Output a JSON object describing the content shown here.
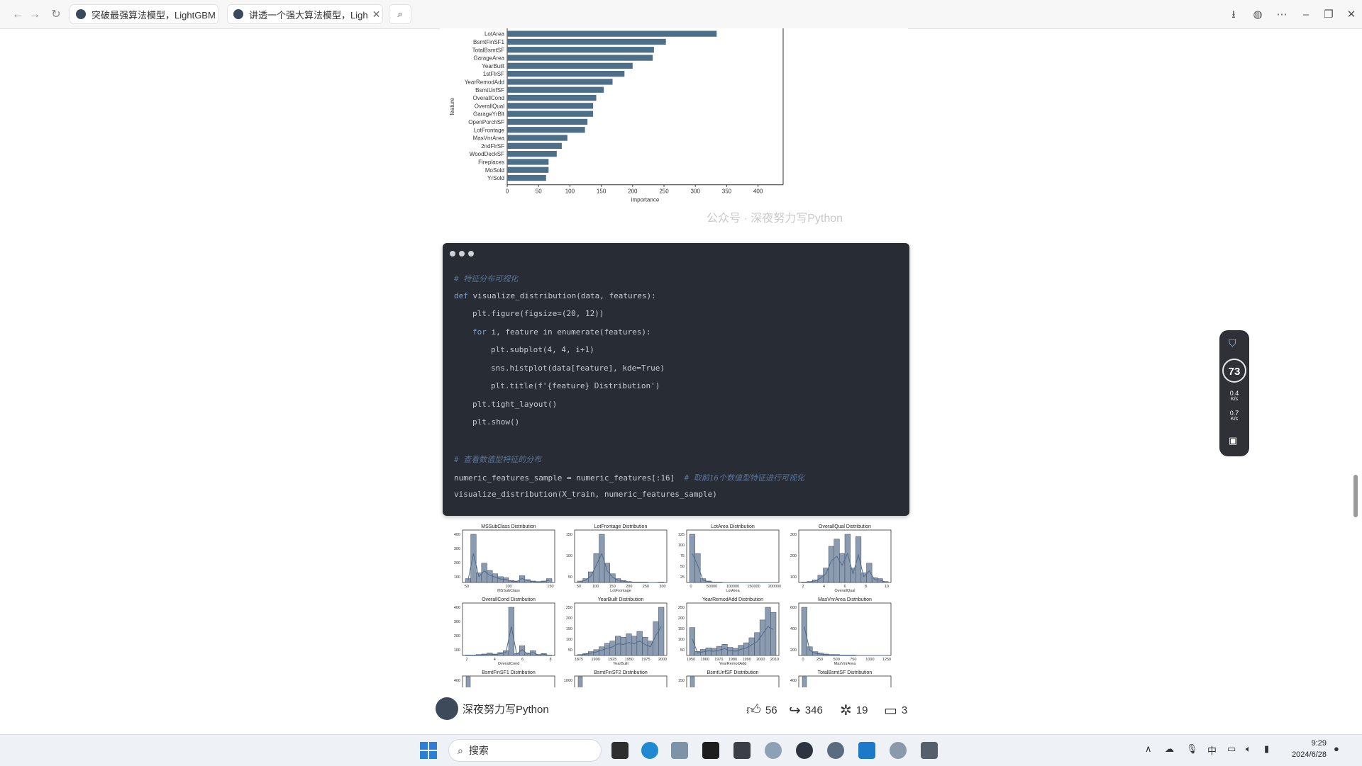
{
  "browser": {
    "tabs": [
      {
        "title": "突破最强算法模型，LightGBM !",
        "active": true
      },
      {
        "title": "讲透一个强大算法模型，Ligh",
        "active": false
      }
    ]
  },
  "feature_chart": {
    "type": "bar",
    "orientation": "horizontal",
    "categories": [
      "LotArea",
      "BsmtFinSF1",
      "TotalBsmtSF",
      "GarageArea",
      "YearBuilt",
      "1stFlrSF",
      "YearRemodAdd",
      "BsmtUnfSF",
      "OverallCond",
      "OverallQual",
      "GarageYrBlt",
      "OpenPorchSF",
      "LotFrontage",
      "MasVnrArea",
      "2ndFlrSF",
      "WoodDeckSF",
      "Fireplaces",
      "MoSold",
      "YrSold"
    ],
    "values": [
      334,
      253,
      234,
      232,
      200,
      187,
      168,
      154,
      142,
      137,
      137,
      128,
      124,
      96,
      87,
      79,
      66,
      66,
      62
    ],
    "xlabel": "importance",
    "ylabel": "feature",
    "xticks": [
      "0",
      "50",
      "100",
      "150",
      "200",
      "250",
      "300",
      "350",
      "400"
    ],
    "xlim": [
      0,
      440
    ],
    "bar_color": "#4e6f8a",
    "watermark": "公众号 · 深夜努力写Python"
  },
  "code": {
    "lines": [
      {
        "indent": 0,
        "type": "comment",
        "text": "# 特征分布可视化"
      },
      {
        "indent": 0,
        "type": "def",
        "kw": "def",
        "text": " visualize_distribution(data, features):"
      },
      {
        "indent": 1,
        "type": "plain",
        "text": "plt.figure(figsize=(20, 12))"
      },
      {
        "indent": 1,
        "type": "for",
        "kw": "for",
        "text": " i, feature in enumerate(features):"
      },
      {
        "indent": 2,
        "type": "plain",
        "text": "plt.subplot(4, 4, i+1)"
      },
      {
        "indent": 2,
        "type": "plain",
        "text": "sns.histplot(data[feature], kde=True)"
      },
      {
        "indent": 2,
        "type": "plain",
        "text": "plt.title(f'{feature} Distribution')"
      },
      {
        "indent": 1,
        "type": "plain",
        "text": "plt.tight_layout()"
      },
      {
        "indent": 1,
        "type": "plain",
        "text": "plt.show()"
      },
      {
        "indent": 0,
        "type": "blank",
        "text": ""
      },
      {
        "indent": 0,
        "type": "comment",
        "text": "# 查看数值型特征的分布"
      },
      {
        "indent": 0,
        "type": "plain",
        "text": "numeric_features_sample = numeric_features[:16]",
        "trail": "  # 取前16个数值型特征进行可视化"
      },
      {
        "indent": 0,
        "type": "plain",
        "text": "visualize_distribution(X_train, numeric_features_sample)"
      }
    ]
  },
  "hist_grid": {
    "panels": [
      {
        "title": "MSSubClass Distribution",
        "xlabel": "MSSubClass",
        "xticks": [
          "50",
          "100",
          "150"
        ],
        "yticks": [
          "400",
          "300",
          "200",
          "100"
        ],
        "bins": [
          8,
          100,
          20,
          40,
          25,
          18,
          12,
          10,
          4,
          3,
          14,
          6,
          3,
          2,
          3,
          8
        ]
      },
      {
        "title": "LotFrontage Distribution",
        "xlabel": "LotFrontage",
        "xticks": [
          "50",
          "100",
          "150",
          "200",
          "250",
          "300"
        ],
        "yticks": [
          "150",
          "100",
          "50"
        ],
        "bins": [
          3,
          8,
          22,
          60,
          100,
          40,
          18,
          8,
          4,
          2,
          1,
          1,
          1,
          0,
          0,
          1
        ]
      },
      {
        "title": "LotArea Distribution",
        "xlabel": "LotArea",
        "xticks": [
          "0",
          "50000",
          "100000",
          "150000",
          "200000"
        ],
        "yticks": [
          "125",
          "100",
          "75",
          "50",
          "25"
        ],
        "bins": [
          100,
          60,
          8,
          3,
          1,
          1,
          0,
          0,
          0,
          0,
          0,
          0,
          0,
          0,
          0,
          0
        ]
      },
      {
        "title": "OverallQual Distribution",
        "xlabel": "OverallQual",
        "xticks": [
          "2",
          "4",
          "6",
          "8",
          "10"
        ],
        "yticks": [
          "300",
          "200",
          "100"
        ],
        "bins": [
          1,
          2,
          5,
          15,
          30,
          75,
          90,
          60,
          100,
          30,
          95,
          20,
          40,
          10,
          8,
          2
        ]
      },
      {
        "title": "OverallCond Distribution",
        "xlabel": "OverallCond",
        "xticks": [
          "2",
          "4",
          "6",
          "8"
        ],
        "yticks": [
          "400",
          "300",
          "200",
          "100"
        ],
        "bins": [
          1,
          1,
          2,
          3,
          5,
          3,
          6,
          10,
          100,
          4,
          20,
          5,
          10,
          2,
          4,
          1
        ]
      },
      {
        "title": "YearBuilt Distribution",
        "xlabel": "YearBuilt",
        "xticks": [
          "1875",
          "1900",
          "1925",
          "1950",
          "1975",
          "2000"
        ],
        "yticks": [
          "250",
          "200",
          "150",
          "100",
          "50"
        ],
        "bins": [
          2,
          4,
          8,
          12,
          18,
          25,
          30,
          40,
          38,
          45,
          40,
          50,
          38,
          30,
          70,
          100
        ]
      },
      {
        "title": "YearRemodAdd Distribution",
        "xlabel": "YearRemodAdd",
        "xticks": [
          "1950",
          "1960",
          "1970",
          "1980",
          "1990",
          "2000",
          "2010"
        ],
        "yticks": [
          "250",
          "200",
          "150",
          "100",
          "50"
        ],
        "bins": [
          55,
          8,
          12,
          15,
          14,
          18,
          22,
          16,
          14,
          20,
          25,
          35,
          45,
          70,
          95,
          85
        ]
      },
      {
        "title": "MasVnrArea Distribution",
        "xlabel": "MasVnrArea",
        "xticks": [
          "0",
          "250",
          "500",
          "750",
          "1000",
          "1250"
        ],
        "yticks": [
          "600",
          "400",
          "200"
        ],
        "bins": [
          100,
          18,
          8,
          5,
          3,
          2,
          2,
          1,
          1,
          1,
          0,
          0,
          0,
          0,
          0,
          0
        ]
      }
    ],
    "partial_titles": [
      "BsmtFinSF1 Distribution",
      "BsmtFinSF2 Distribution",
      "BsmtUnfSF Distribution",
      "TotalBsmtSF Distribution"
    ],
    "partial_yticks": [
      "400",
      "1000",
      "150",
      "400"
    ],
    "bar_color": "#8b9bb0",
    "line_color": "#4f6a8f"
  },
  "footer": {
    "author": "深夜努力写Python",
    "likes": "56",
    "shares": "346",
    "favorites": "19",
    "comments": "3"
  },
  "widget": {
    "score": "73",
    "up_speed": "0.4",
    "down_speed": "0.7",
    "unit": "K/s"
  },
  "taskbar": {
    "search_placeholder": "搜索",
    "ime": "中",
    "time": "9:29",
    "date": "2024/6/28"
  }
}
